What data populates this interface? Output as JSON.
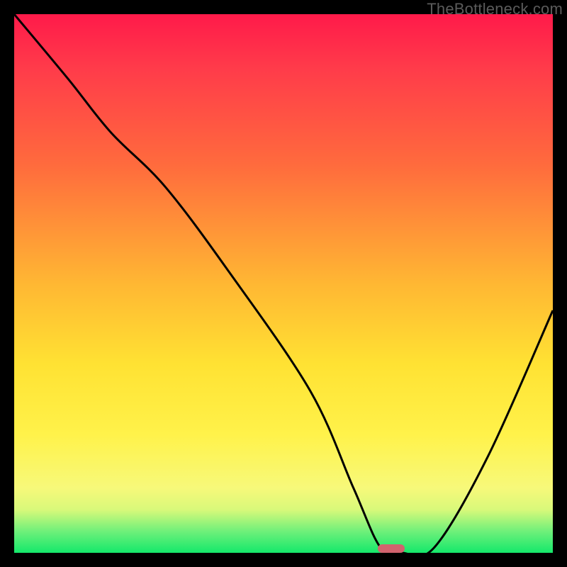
{
  "watermark": "TheBottleneck.com",
  "chart_data": {
    "type": "line",
    "title": "",
    "xlabel": "",
    "ylabel": "",
    "xlim": [
      0,
      100
    ],
    "ylim": [
      0,
      100
    ],
    "series": [
      {
        "name": "bottleneck-curve",
        "x": [
          0,
          10,
          18,
          28,
          40,
          55,
          63,
          68,
          72,
          78,
          88,
          100
        ],
        "y": [
          100,
          88,
          78,
          68,
          52,
          30,
          12,
          1,
          0,
          1,
          18,
          45
        ]
      }
    ],
    "marker": {
      "x_center": 70,
      "y": 0,
      "width_pct": 5
    },
    "gradient_stops": [
      {
        "pct": 0,
        "color": "#ff1a4a"
      },
      {
        "pct": 28,
        "color": "#ff6b3d"
      },
      {
        "pct": 50,
        "color": "#ffb733"
      },
      {
        "pct": 78,
        "color": "#fff24a"
      },
      {
        "pct": 100,
        "color": "#14e86b"
      }
    ]
  }
}
